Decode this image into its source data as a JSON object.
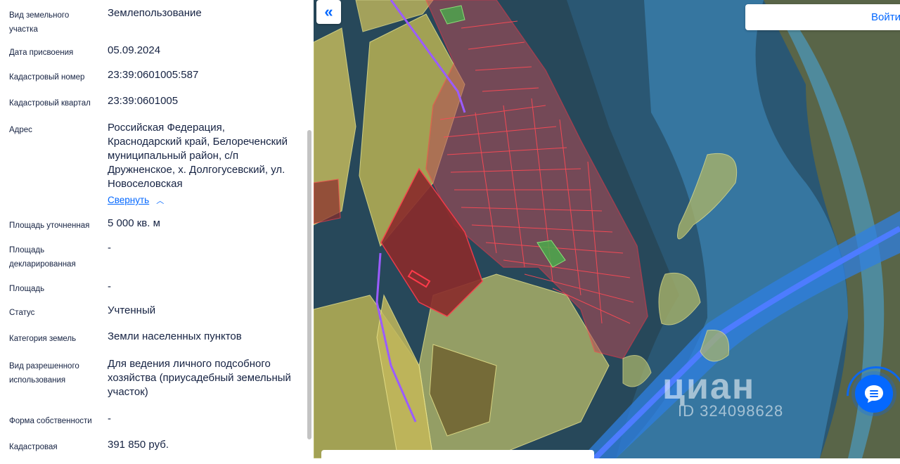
{
  "fields": [
    {
      "label": "Вид земельного участка",
      "value": "Землепользование"
    },
    {
      "label": "Дата присвоения",
      "value": "05.09.2024"
    },
    {
      "label": "Кадастровый номер",
      "value": "23:39:0601005:587"
    },
    {
      "label": "Кадастровый квартал",
      "value": "23:39:0601005"
    },
    {
      "label": "Адрес",
      "value": "Российская Федерация, Краснодарский край, Белореченский муниципальный район, с/п Дружненское, х. Долгогусевский, ул. Новоселовская"
    },
    {
      "label": "Площадь уточненная",
      "value": "5 000 кв. м"
    },
    {
      "label": "Площадь декларированная",
      "value": "-"
    },
    {
      "label": "Площадь",
      "value": "-"
    },
    {
      "label": "Статус",
      "value": "Учтенный"
    },
    {
      "label": "Категория земель",
      "value": "Земли населенных пунктов"
    },
    {
      "label": "Вид разрешенного использования",
      "value": "Для ведения личного подсобного хозяйства (приусадебный земельный участок)"
    },
    {
      "label": "Форма собственности",
      "value": "-"
    },
    {
      "label": "Кадастровая",
      "value": "391 850 руб."
    }
  ],
  "address_toggle": "Свернуть",
  "map": {
    "collapse_icon": "«",
    "login_label": "Войти",
    "watermark_brand": "циан",
    "watermark_id": "ID 324098628"
  },
  "colors": {
    "accent": "#0468ff",
    "parcel_red": "#e8343f",
    "zone_yellow": "#c9c25a",
    "water_blue": "#2e8fd9"
  }
}
